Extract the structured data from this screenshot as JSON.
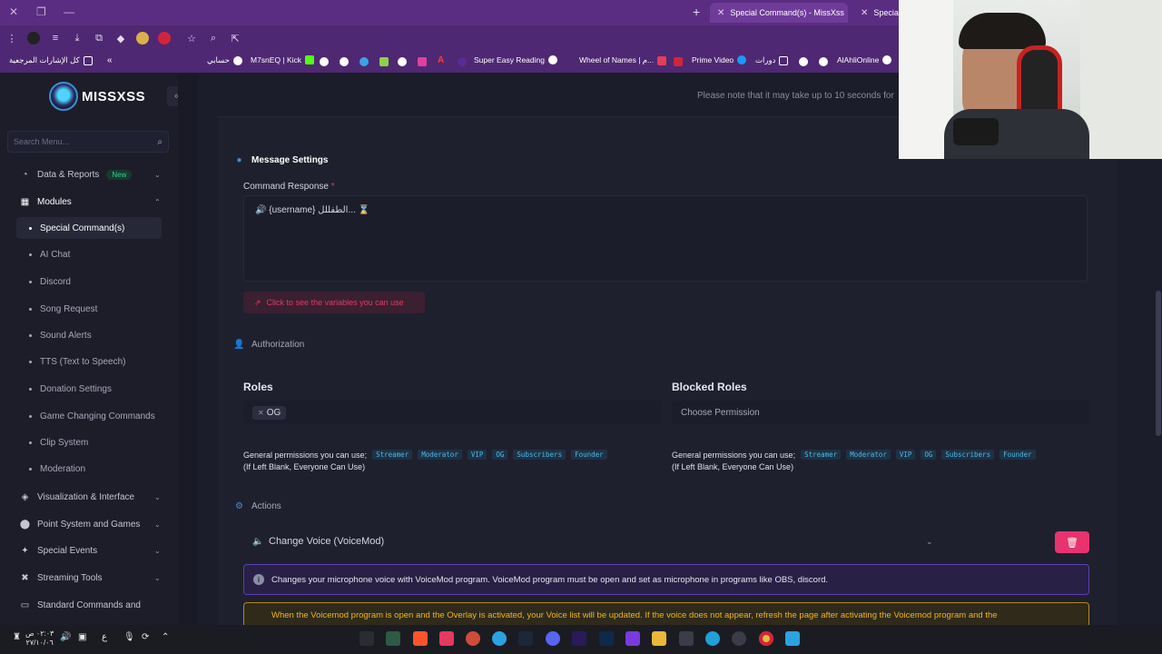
{
  "browser": {
    "tabs": [
      {
        "title": "Special Command(s) - MissXss",
        "active": true
      },
      {
        "title": "Special",
        "active": false
      }
    ],
    "bookmarks": [
      {
        "label": "كل الإشارات المرجعية"
      },
      {
        "label": "حسابي"
      },
      {
        "label": "M7snEQ | Kick"
      },
      {
        "label": "Super Easy Reading"
      },
      {
        "label": "Wheel of Names | م..."
      },
      {
        "label": "Prime Video"
      },
      {
        "label": "دورات"
      },
      {
        "label": "AlAhliOnline"
      }
    ]
  },
  "brand": {
    "name": "MISSXSS"
  },
  "search": {
    "placeholder": "Search Menu..."
  },
  "notice": "Please note that it may take up to 10 seconds for",
  "sidebar": {
    "items": [
      {
        "label": "Data & Reports",
        "badge": "New",
        "icon": "chart-icon"
      },
      {
        "label": "Modules",
        "icon": "grid-icon"
      },
      {
        "label": "Visualization & Interface",
        "icon": "layers-icon"
      },
      {
        "label": "Point System and Games",
        "icon": "coins-icon"
      },
      {
        "label": "Special Events",
        "icon": "star-icon"
      },
      {
        "label": "Streaming Tools",
        "icon": "tools-icon"
      },
      {
        "label": "Standard Commands and",
        "icon": "terminal-icon"
      }
    ],
    "modules": [
      {
        "label": "Special Command(s)",
        "active": true
      },
      {
        "label": "AI Chat"
      },
      {
        "label": "Discord"
      },
      {
        "label": "Song Request"
      },
      {
        "label": "Sound Alerts"
      },
      {
        "label": "TTS (Text to Speech)"
      },
      {
        "label": "Donation Settings"
      },
      {
        "label": "Game Changing Commands"
      },
      {
        "label": "Clip System"
      },
      {
        "label": "Moderation"
      }
    ]
  },
  "message_settings": {
    "title": "Message Settings",
    "command_response_label": "Command Response",
    "required_mark": "*",
    "response_value": "🔊 {username} الطفللل... ⌛",
    "variables_button": "Click to see the variables you can use"
  },
  "authorization": {
    "title": "Authorization",
    "roles_title": "Roles",
    "roles_chip": "OG",
    "blocked_title": "Blocked Roles",
    "blocked_placeholder": "Choose Permission",
    "perm_prefix": "General permissions you can use;",
    "perm_sub": "(If Left Blank, Everyone Can Use)",
    "perm_tags": [
      "Streamer",
      "Moderator",
      "VIP",
      "OG",
      "Subscribers",
      "Founder"
    ]
  },
  "actions": {
    "title": "Actions",
    "item_label": "Change Voice (VoiceMod)",
    "info": "Changes your microphone voice with VoiceMod program. VoiceMod program must be open and set as microphone in programs like OBS, discord.",
    "warning": "When the Voicemod program is open and the Overlay is activated, your Voice list will be updated. If the voice does not appear, refresh the page after activating the Voicemod program and the"
  },
  "taskbar": {
    "time": "٠٢:٠٣ ص",
    "date": "٢٧/١٠/٠٦",
    "lang": "ع"
  },
  "colors": {
    "accent": "#e8336e",
    "link": "#4fb7ea",
    "warning": "#f2b51e",
    "chrome": "#5b2d82"
  }
}
